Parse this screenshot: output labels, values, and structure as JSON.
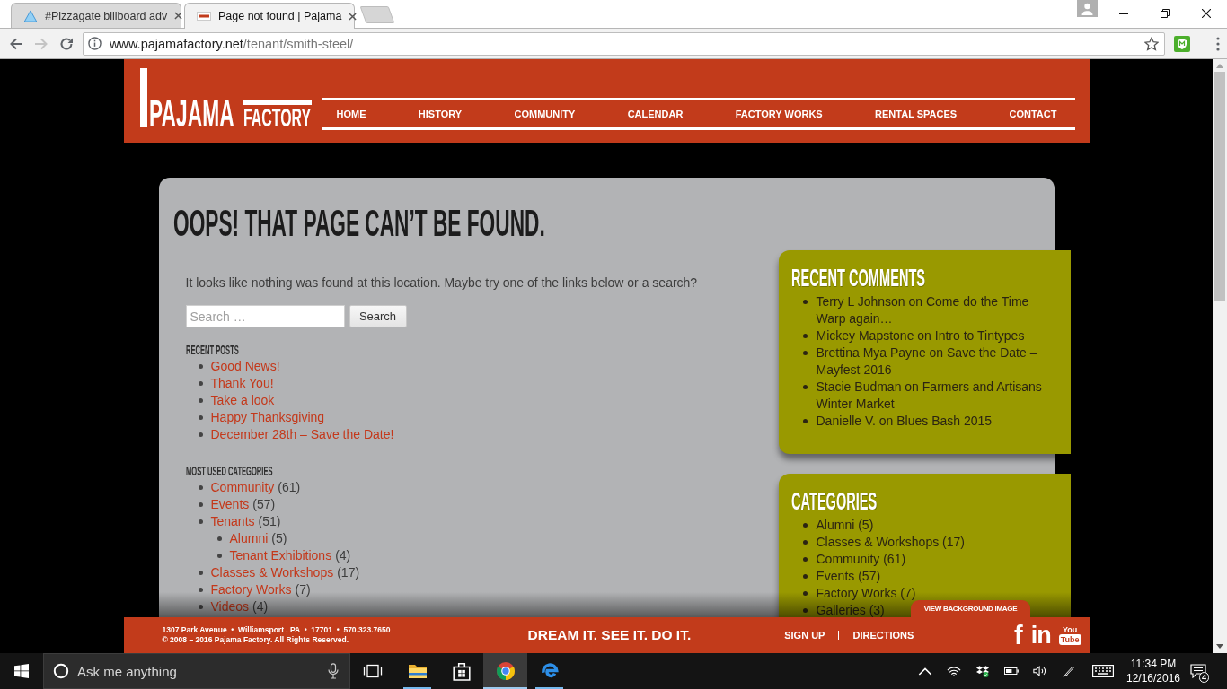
{
  "browser": {
    "tabs": [
      {
        "title": "#Pizzagate billboard adv",
        "kind": "triangle",
        "selected": false
      },
      {
        "title": "Page not found | Pajama",
        "kind": "logo",
        "selected": true
      }
    ],
    "navigation": {
      "back_disabled": false,
      "forward_disabled": true
    },
    "url": {
      "host": "www.pajamafactory.net",
      "path": "/tenant/smith-steel/"
    }
  },
  "header": {
    "logo": {
      "big": "PAJAMA",
      "small": "FACTORY"
    },
    "nav": [
      "HOME",
      "HISTORY",
      "COMMUNITY",
      "CALENDAR",
      "FACTORY WORKS",
      "RENTAL SPACES",
      "CONTACT"
    ]
  },
  "page": {
    "title": "OOPS! THAT PAGE CAN’T BE FOUND.",
    "intro": "It looks like nothing was found at this location. Maybe try one of the links below or a search?",
    "search": {
      "placeholder": "Search …",
      "button": "Search"
    },
    "recent_posts": {
      "heading": "RECENT POSTS",
      "items": [
        "Good News!",
        "Thank You!",
        "Take a look",
        "Happy Thanksgiving",
        "December 28th – Save the Date!"
      ]
    },
    "categories": {
      "heading": "MOST USED CATEGORIES",
      "items": [
        {
          "name": "Community",
          "count": "(61)"
        },
        {
          "name": "Events",
          "count": "(57)"
        },
        {
          "name": "Tenants",
          "count": "(51)",
          "children": [
            {
              "name": "Alumni",
              "count": "(5)"
            },
            {
              "name": "Tenant Exhibitions",
              "count": "(4)"
            }
          ]
        },
        {
          "name": "Classes & Workshops",
          "count": "(17)"
        },
        {
          "name": "Factory Works",
          "count": "(7)"
        },
        {
          "name": "Videos",
          "count": "(4)"
        }
      ]
    }
  },
  "sidebar": [
    {
      "heading": "RECENT COMMENTS",
      "items": [
        "Terry L Johnson on Come do the Time Warp again…",
        "Mickey Mapstone on Intro to Tintypes",
        "Brettina Mya Payne on Save the Date – Mayfest 2016",
        "Stacie Budman on Farmers and Artisans Winter Market",
        "Danielle V. on Blues Bash 2015"
      ]
    },
    {
      "heading": "CATEGORIES",
      "items": [
        "Alumni (5)",
        "Classes & Workshops (17)",
        "Community (61)",
        "Events (57)",
        "Factory Works (7)",
        "Galleries (3)"
      ]
    }
  ],
  "footer": {
    "view_background_button": "VIEW BACKGROUND IMAGE",
    "address": "1307 Park Avenue  •  Williamsport , PA  •  17701  •  570.323.7650",
    "copyright": "© 2008 – 2016 Pajama Factory. All Rights Reserved.",
    "slogan": "DREAM IT. SEE IT. DO IT.",
    "links": [
      "SIGN UP",
      "DIRECTIONS"
    ],
    "social": [
      {
        "kind": "facebook",
        "label": "f"
      },
      {
        "kind": "linkedin",
        "label": "in"
      },
      {
        "kind": "youtube",
        "label": "You",
        "label_2": "Tube"
      }
    ]
  },
  "taskbar": {
    "search": {
      "placeholder": "Ask me anything"
    },
    "apps": [
      {
        "kind": "folder",
        "running": true,
        "selected": false
      },
      {
        "kind": "store",
        "running": false,
        "selected": false
      },
      {
        "kind": "browser",
        "running": true,
        "selected": true
      },
      {
        "kind": "swirl",
        "running": true,
        "selected": false
      }
    ],
    "clock": {
      "time": "11:34 PM",
      "date": "12/16/2016"
    },
    "notifications": "4"
  }
}
